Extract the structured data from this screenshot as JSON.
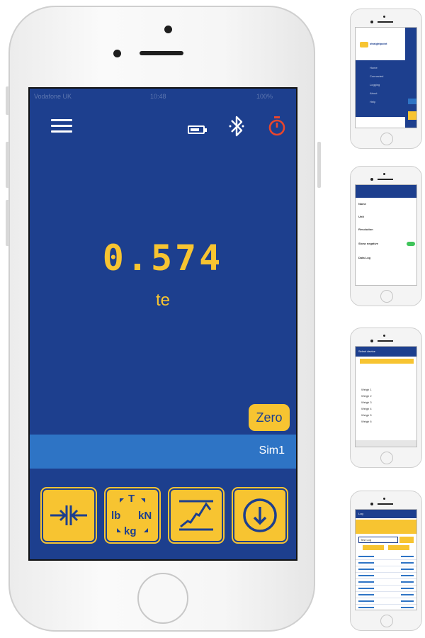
{
  "main_screen": {
    "status_bar": {
      "carrier": "Vodafone UK",
      "time": "10:48",
      "battery": "100%"
    },
    "reading": "0.574",
    "unit": "te",
    "zero_label": "Zero",
    "device_name": "Sim1",
    "toolbar": {
      "units_letters": {
        "top": "T",
        "left": "lb",
        "right": "kN",
        "bottom": "kg"
      }
    },
    "colors": {
      "background": "#1d3f8e",
      "accent": "#f7c431",
      "sim_bar": "#2e74c5",
      "timer": "#e8462c"
    }
  },
  "thumbnails": {
    "menu": {
      "brand": "straightpoint",
      "items": [
        "Home",
        "Connected",
        "Logging",
        "About",
        "Help"
      ]
    },
    "settings": {
      "rows": [
        {
          "title": "Name",
          "toggle": false
        },
        {
          "title": "Unit",
          "toggle": false
        },
        {
          "title": "Resolution",
          "toggle": false
        },
        {
          "title": "Show negative",
          "toggle": true
        },
        {
          "title": "Data Log",
          "toggle": false
        }
      ]
    },
    "devices": {
      "header": "Select device",
      "rows": [
        "Weigh 1",
        "Weigh 2",
        "Weigh 3",
        "Weigh 4",
        "Weigh 5",
        "Weigh 6"
      ]
    },
    "log": {
      "header": "Log",
      "input_value": "Test Log",
      "row_count": 9
    }
  }
}
